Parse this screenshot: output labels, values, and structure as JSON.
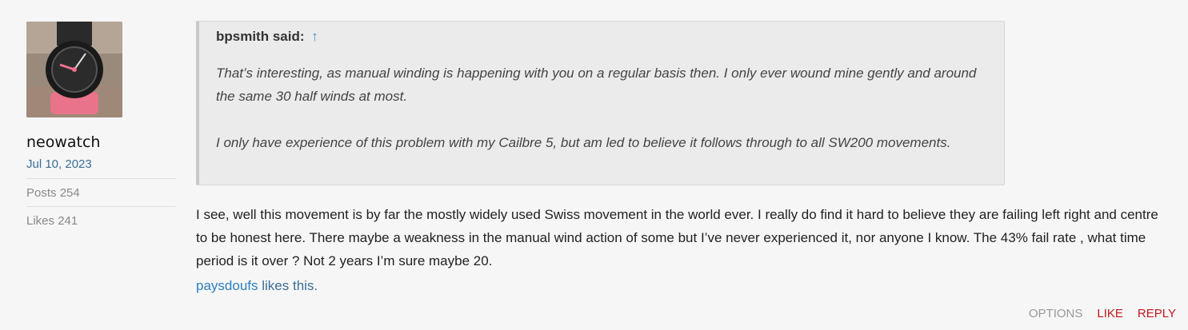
{
  "user": {
    "username": "neowatch",
    "join_date": "Jul 10, 2023",
    "posts_label": "Posts",
    "posts": "254",
    "likes_label": "Likes",
    "likes": "241"
  },
  "quote": {
    "author_said": "bpsmith said:",
    "arrow": "↑",
    "paragraphs": [
      "That’s interesting, as manual winding is happening with you on a regular basis then. I only ever wound mine gently and around the same 30 half winds at most.",
      "I only have experience of this problem with my Cailbre 5, but am led to believe it follows through to all SW200 movements."
    ]
  },
  "message": "I see, well this movement is by far the mostly widely used Swiss movement in the world ever. I really do find it hard to believe they are failing left right and centre to be honest here. There maybe a weakness in the manual wind action of some but I’ve never experienced it, nor anyone I know. The 43% fail rate , what time period is it over ? Not 2 years I’m sure maybe 20.",
  "likes_line": {
    "user": "paysdoufs",
    "text": "likes this."
  },
  "actions": {
    "options": "OPTIONS",
    "like": "LIKE",
    "reply": "REPLY"
  }
}
